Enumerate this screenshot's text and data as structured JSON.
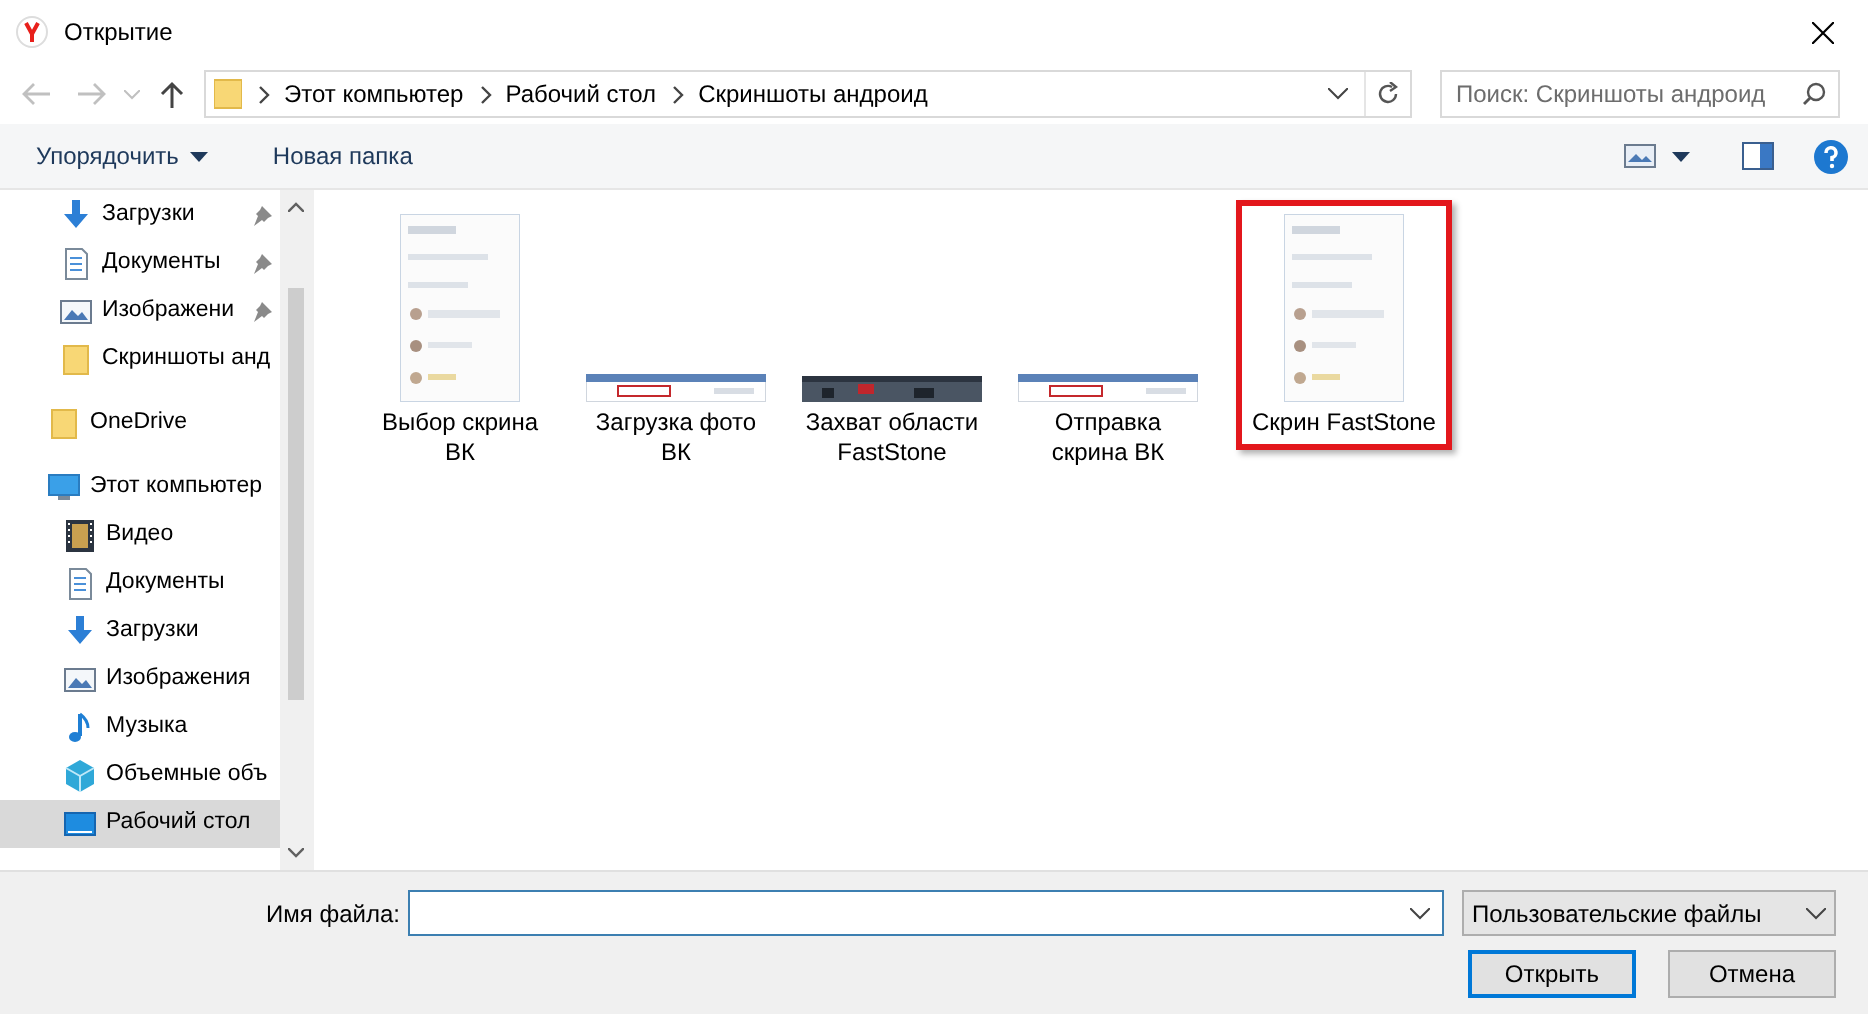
{
  "window": {
    "title": "Открытие"
  },
  "address": {
    "path": [
      "Этот компьютер",
      "Рабочий стол",
      "Скриншоты андроид"
    ]
  },
  "search": {
    "placeholder": "Поиск: Скриншоты андроид"
  },
  "toolbar": {
    "organize": "Упорядочить",
    "new_folder": "Новая папка"
  },
  "sidebar": {
    "quick_access": [
      {
        "label": "Загрузки",
        "kind": "downloads",
        "pinned": true,
        "selected": false
      },
      {
        "label": "Документы",
        "kind": "documents",
        "pinned": true,
        "selected": false
      },
      {
        "label": "Изображени",
        "kind": "pictures",
        "pinned": true,
        "selected": false
      },
      {
        "label": "Скриншоты анд",
        "kind": "folder",
        "pinned": false,
        "selected": false
      }
    ],
    "items": [
      {
        "label": "OneDrive",
        "kind": "folder",
        "selected": false
      },
      {
        "label": "Этот компьютер",
        "kind": "computer",
        "selected": false,
        "children": [
          {
            "label": "Видео",
            "kind": "video",
            "selected": false
          },
          {
            "label": "Документы",
            "kind": "documents",
            "selected": false
          },
          {
            "label": "Загрузки",
            "kind": "downloads",
            "selected": false
          },
          {
            "label": "Изображения",
            "kind": "pictures",
            "selected": false
          },
          {
            "label": "Музыка",
            "kind": "music",
            "selected": false
          },
          {
            "label": "Объемные объ",
            "kind": "objects",
            "selected": false
          },
          {
            "label": "Рабочий стол",
            "kind": "desktop",
            "selected": true
          }
        ]
      }
    ]
  },
  "files": [
    {
      "name": "Выбор скрина\nВК",
      "kind": "portrait",
      "selected": false
    },
    {
      "name": "Загрузка фото\nВК",
      "kind": "banner",
      "selected": false
    },
    {
      "name": "Захват области\nFastStone",
      "kind": "dark_banner",
      "selected": false
    },
    {
      "name": "Отправка\nскрина ВК",
      "kind": "banner",
      "selected": false
    },
    {
      "name": "Скрин FastStone",
      "kind": "portrait",
      "selected": true
    }
  ],
  "footer": {
    "filename_label": "Имя файла:",
    "filter": "Пользовательские файлы",
    "open": "Открыть",
    "cancel": "Отмена"
  }
}
